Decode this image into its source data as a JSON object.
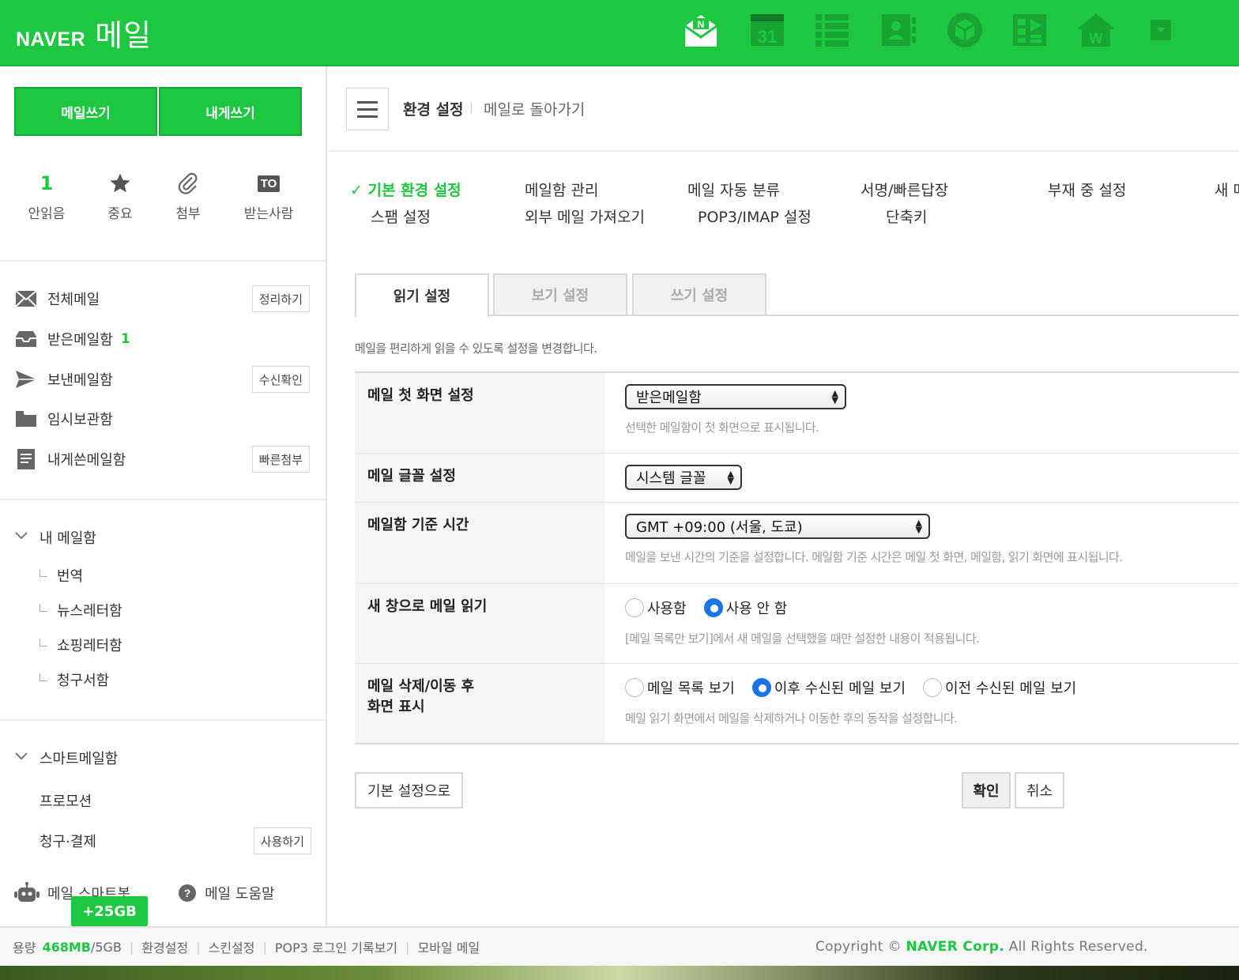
{
  "header": {
    "logo_brand": "NAVER",
    "logo_service": "메일"
  },
  "sidebar": {
    "write_mail": "메일쓰기",
    "write_to_me": "내게쓰기",
    "quick": [
      {
        "value": "1",
        "label": "안읽음"
      },
      {
        "label": "중요"
      },
      {
        "label": "첨부"
      },
      {
        "icon_text": "TO",
        "label": "받는사람"
      }
    ],
    "folders": [
      {
        "label": "전체메일",
        "button": "정리하기"
      },
      {
        "label": "받은메일함",
        "count": "1"
      },
      {
        "label": "보낸메일함",
        "button": "수신확인"
      },
      {
        "label": "임시보관함"
      },
      {
        "label": "내게쓴메일함",
        "button": "빠른첨부"
      }
    ],
    "my_mailbox": {
      "label": "내 메일함",
      "items": [
        "번역",
        "뉴스레터함",
        "쇼핑레터함",
        "청구서함"
      ]
    },
    "smart_mailbox": {
      "label": "스마트메일함",
      "promotion": "프로모션",
      "billing": "청구·결제",
      "billing_button": "사용하기"
    },
    "smartbot": "메일 스마트봇",
    "help": "메일 도움말",
    "storage_tip": "+25GB"
  },
  "main": {
    "breadcrumb_title": "환경 설정",
    "breadcrumb_back": "메일로 돌아가기",
    "nav": {
      "check": "✓",
      "basic": "기본 환경 설정",
      "spam": "스팸 설정",
      "mailbox_manage": "메일함 관리",
      "external": "외부 메일 가져오기",
      "auto_sort": "메일 자동 분류",
      "pop3": "POP3/IMAP 설정",
      "signature": "서명/빠른답장",
      "shortcut": "단축키",
      "absence": "부재 중 설정",
      "new": "새 메"
    },
    "tabs": [
      "읽기 설정",
      "보기 설정",
      "쓰기 설정"
    ],
    "description": "메일을 편리하게 읽을 수 있도록 설정을 변경합니다.",
    "rows": {
      "first_screen": {
        "label": "메일 첫 화면 설정",
        "selected": "받은메일함",
        "help": "선택한 메일함이 첫 화면으로 표시됩니다."
      },
      "font": {
        "label": "메일 글꼴 설정",
        "selected": "시스템 글꼴"
      },
      "timezone": {
        "label": "메일함 기준 시간",
        "selected": "GMT +09:00 (서울, 도쿄)",
        "help": "메일을 보낸 시간의 기준을 설정합니다. 메일함 기준 시간은 메일 첫 화면, 메일함, 읽기 화면에 표시됩니다."
      },
      "new_window": {
        "label": "새 창으로 메일 읽기",
        "options": [
          "사용함",
          "사용 안 함"
        ],
        "selected_index": 1,
        "help": "[메일 목록만 보기]에서 새 메일을 선택했을 때만 설정한 내용이 적용됩니다."
      },
      "after_delete": {
        "label_line1": "메일 삭제/이동 후",
        "label_line2": "화면 표시",
        "options": [
          "메일 목록 보기",
          "이후 수신된 메일 보기",
          "이전 수신된 메일 보기"
        ],
        "selected_index": 1,
        "help": "메일 읽기 화면에서 메일을 삭제하거나 이동한 후의 동작을 설정합니다."
      }
    },
    "reset_button": "기본 설정으로",
    "ok_button": "확인",
    "cancel_button": "취소"
  },
  "footer": {
    "capacity_label": "용량",
    "used": "468MB",
    "total": "/5GB",
    "links": [
      "환경설정",
      "스킨설정",
      "POP3 로그인 기록보기",
      "모바일 메일"
    ],
    "copyright_prefix": "Copyright ©",
    "corp": "NAVER Corp.",
    "rights": "All Rights Reserved."
  },
  "colors": {
    "brand_green": "#1ec740",
    "radio_blue": "#1a73e8"
  }
}
